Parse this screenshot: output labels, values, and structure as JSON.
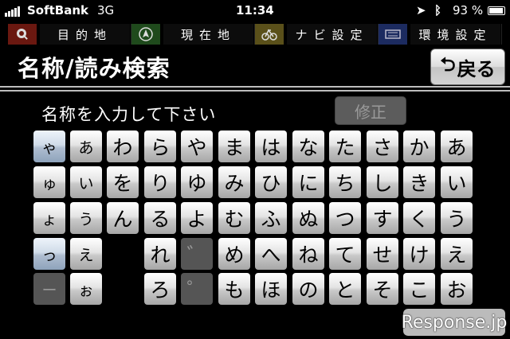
{
  "status": {
    "carrier": "SoftBank",
    "network": "3G",
    "time": "11:34",
    "battery": "93 %"
  },
  "nav": [
    {
      "label": "目的地",
      "icon": "search-icon"
    },
    {
      "label": "現在地",
      "icon": "location-icon"
    },
    {
      "label": "ナビ設定",
      "icon": "car-icon"
    },
    {
      "label": "環境設定",
      "icon": "settings-icon"
    }
  ],
  "header": {
    "title": "名称/読み検索",
    "back_label": "戻る"
  },
  "input": {
    "prompt": "名称を入力して下さい",
    "fix_label": "修正"
  },
  "keyboard": {
    "rows": [
      [
        "ゃ",
        "あ",
        "わ",
        "ら",
        "や",
        "ま",
        "は",
        "な",
        "た",
        "さ",
        "か",
        "あ"
      ],
      [
        "ゅ",
        "い",
        "を",
        "り",
        "ゆ",
        "み",
        "ひ",
        "に",
        "ち",
        "し",
        "き",
        "い"
      ],
      [
        "ょ",
        "う",
        "ん",
        "る",
        "よ",
        "む",
        "ふ",
        "ぬ",
        "つ",
        "す",
        "く",
        "う"
      ],
      [
        "っ",
        "え",
        "",
        "れ",
        "゛",
        "め",
        "へ",
        "ね",
        "て",
        "せ",
        "け",
        "え"
      ],
      [
        "ー",
        "ぉ",
        "",
        "ろ",
        "゜",
        "も",
        "ほ",
        "の",
        "と",
        "そ",
        "こ",
        "お"
      ]
    ]
  },
  "watermark": "Response.jp"
}
